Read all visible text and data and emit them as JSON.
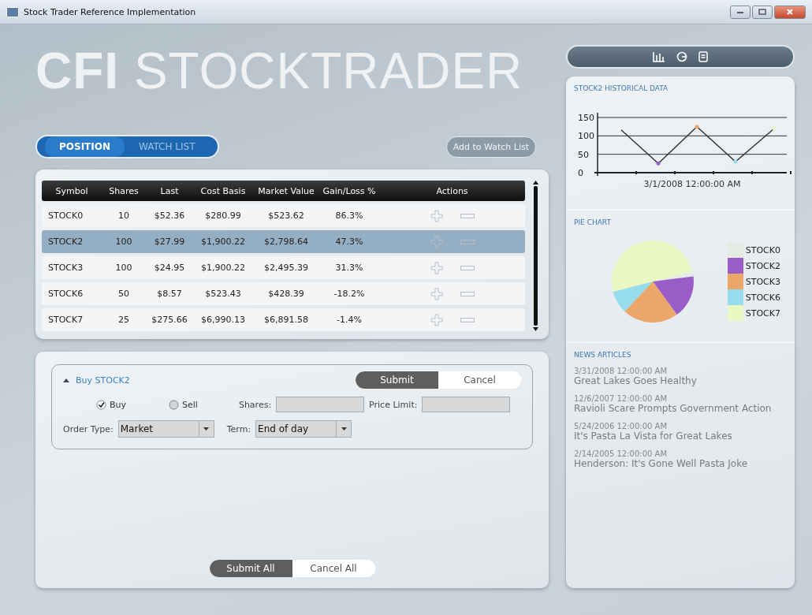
{
  "window": {
    "title": "Stock Trader Reference Implementation"
  },
  "logo": "**CFI** STOCKTRADER",
  "tabs": [
    {
      "label": "POSITION",
      "selected": true
    },
    {
      "label": "WATCH LIST",
      "selected": false
    }
  ],
  "add_button": "Add to Watch List",
  "table": {
    "columns": [
      "Symbol",
      "Shares",
      "Last",
      "Cost Basis",
      "Market Value",
      "Gain/Loss %",
      "Actions"
    ],
    "rows": [
      {
        "cells": [
          "STOCK0",
          "10",
          "$52.36",
          "$280.99",
          "$523.62",
          "86.3%"
        ],
        "selected": false
      },
      {
        "cells": [
          "STOCK2",
          "100",
          "$27.99",
          "$1,900.22",
          "$2,798.64",
          "47.3%"
        ],
        "selected": true
      },
      {
        "cells": [
          "STOCK3",
          "100",
          "$24.95",
          "$1,900.22",
          "$2,495.39",
          "31.3%"
        ],
        "selected": false
      },
      {
        "cells": [
          "STOCK6",
          "50",
          "$8.57",
          "$523.43",
          "$428.39",
          "-18.2%"
        ],
        "selected": false
      },
      {
        "cells": [
          "STOCK7",
          "25",
          "$275.66",
          "$6,990.13",
          "$6,891.58",
          "-1.4%"
        ],
        "selected": false
      }
    ]
  },
  "order": {
    "title": "Buy STOCK2",
    "submit": "Submit",
    "cancel": "Cancel",
    "sides": [
      {
        "label": "Buy",
        "selected": true
      },
      {
        "label": "Sell",
        "selected": false
      }
    ],
    "shares_label": "Shares:",
    "price_label": "Price Limit:",
    "order_type_label": "Order Type:",
    "order_type": "Market",
    "term_label": "Term:",
    "term": "End of day"
  },
  "submit_all": "Submit All",
  "cancel_all": "Cancel All",
  "history": {
    "title": "STOCK2 HISTORICAL DATA",
    "chart_data": {
      "type": "line",
      "xlabel": "3/1/2008 12:00:00 AM",
      "ylim": [
        0,
        150
      ],
      "yticks": [
        0,
        50,
        100,
        150
      ],
      "series": [
        {
          "color": "#333333",
          "values": [
            120,
            25,
            125,
            30,
            120
          ]
        }
      ]
    }
  },
  "pie": {
    "title": "PIE CHART",
    "legend": [
      {
        "label": "STOCK0",
        "color": "#e4ece4"
      },
      {
        "label": "STOCK2",
        "color": "#9a5cc6"
      },
      {
        "label": "STOCK3",
        "color": "#eba76a"
      },
      {
        "label": "STOCK6",
        "color": "#96dcec"
      },
      {
        "label": "STOCK7",
        "color": "#eaf7c2"
      }
    ]
  },
  "news": {
    "title": "NEWS ARTICLES",
    "articles": [
      {
        "date": "3/31/2008 12:00:00 AM",
        "headline": "Great Lakes Goes Healthy"
      },
      {
        "date": "12/6/2007 12:00:00 AM",
        "headline": "Ravioli Scare Prompts Government Action"
      },
      {
        "date": "5/24/2006 12:00:00 AM",
        "headline": "It's Pasta La Vista for Great Lakes"
      },
      {
        "date": "2/14/2005 12:00:00 AM",
        "headline": "Henderson: It's Gone Well Pasta Joke"
      }
    ]
  }
}
